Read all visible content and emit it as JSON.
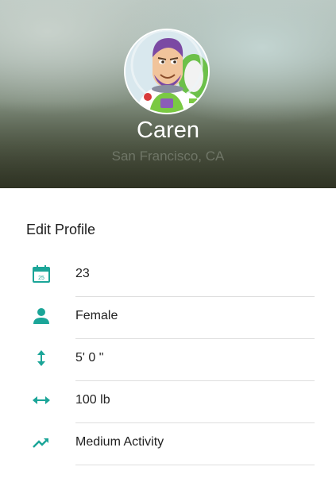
{
  "profile": {
    "name": "Caren",
    "location": "San Francisco, CA"
  },
  "section": {
    "title": "Edit Profile"
  },
  "fields": [
    {
      "icon": "calendar-icon",
      "value": "23",
      "calendar_day": "25"
    },
    {
      "icon": "person-icon",
      "value": "Female"
    },
    {
      "icon": "vertical-arrows-icon",
      "value": "5' 0 \""
    },
    {
      "icon": "horizontal-arrows-icon",
      "value": "100 lb"
    },
    {
      "icon": "trending-up-icon",
      "value": "Medium Activity"
    }
  ],
  "colors": {
    "accent": "#1ba598"
  }
}
